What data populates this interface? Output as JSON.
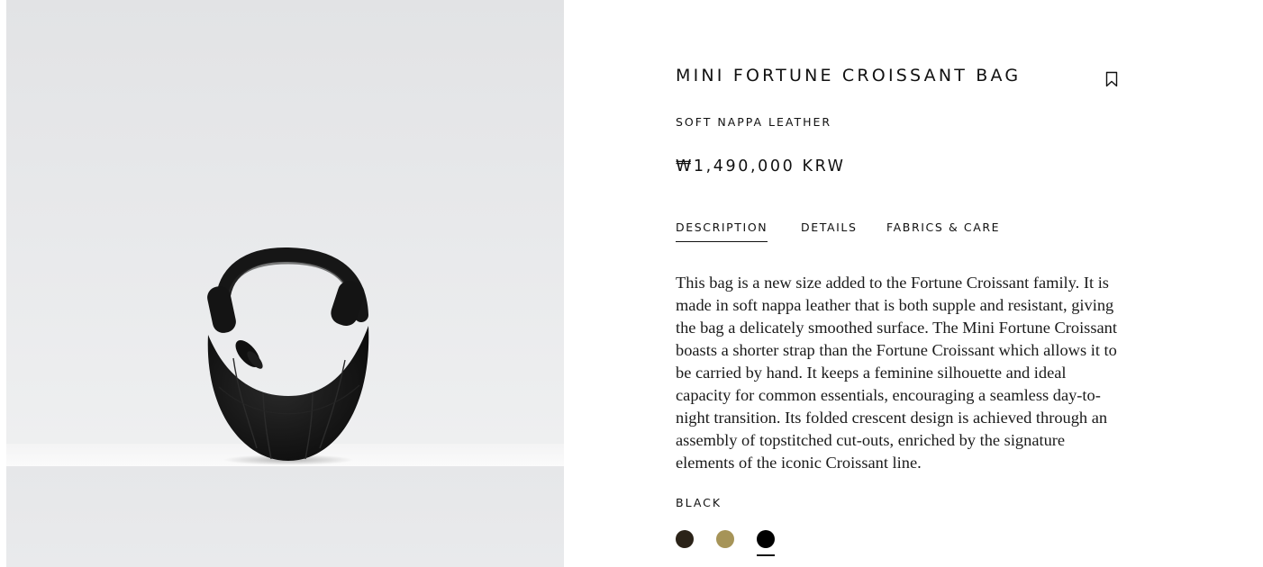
{
  "product": {
    "title": "MINI FORTUNE CROISSANT BAG",
    "subtitle": "SOFT NAPPA LEATHER",
    "price": "₩1,490,000 KRW"
  },
  "tabs": [
    {
      "label": "DESCRIPTION",
      "active": true
    },
    {
      "label": "DETAILS",
      "active": false
    },
    {
      "label": "FABRICS & CARE",
      "active": false
    }
  ],
  "description": "This bag is a new size added to the Fortune Croissant family. It is made in soft nappa leather that is both supple and resistant, giving the bag a delicately smoothed surface. The Mini Fortune Croissant boasts a shorter strap than the Fortune Croissant which allows it to be carried by hand. It keeps a feminine silhouette and ideal capacity for common essentials, encouraging a seamless day-to-night transition. Its folded crescent design is achieved through an assembly of topstitched cut-outs, enriched by the signature elements of the iconic Croissant line.",
  "color": {
    "selected_label": "BLACK",
    "swatches": [
      {
        "hex": "#2a2218",
        "selected": false
      },
      {
        "hex": "#a69458",
        "selected": false
      },
      {
        "hex": "#000000",
        "selected": true
      }
    ]
  },
  "icons": {
    "bookmark": "bookmark-icon"
  }
}
